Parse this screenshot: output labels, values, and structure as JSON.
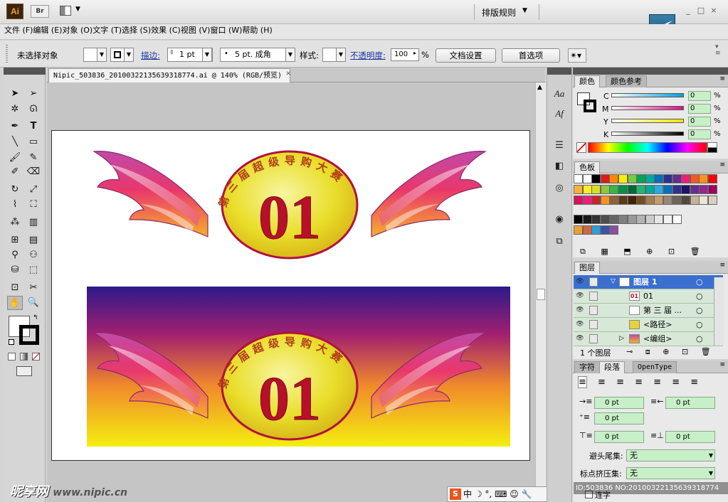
{
  "app": {
    "logo": "Ai",
    "bridge": "Br",
    "workspace": "排版规则",
    "window_controls": [
      "_",
      "□",
      "×"
    ]
  },
  "menu": [
    "文件 (F)",
    "编辑 (E)",
    "对象 (O)",
    "文字 (T)",
    "选择 (S)",
    "效果 (C)",
    "视图 (V)",
    "窗口 (W)",
    "帮助 (H)"
  ],
  "control_bar": {
    "selection_status": "未选择对象",
    "stroke_label": "描边:",
    "stroke_weight": "1 pt",
    "brush": "5 pt. 成角",
    "style_label": "样式:",
    "opacity_label": "不透明度:",
    "opacity_value": "100",
    "opacity_unit": "%",
    "doc_setup_button": "文档设置",
    "preferences_button": "首选项"
  },
  "document": {
    "tab_title": "Nipic_503836_20100322135639318774.ai @ 140% (RGB/预览)",
    "close_glyph": "×"
  },
  "artwork": {
    "badge_top": {
      "number": "01",
      "arc_text": [
        "第",
        "三",
        "届",
        "超",
        "级",
        "导",
        "购",
        "大",
        "赛"
      ]
    },
    "badge_bottom": {
      "number": "01",
      "arc_text": [
        "第",
        "三",
        "届",
        "超",
        "级",
        "导",
        "购",
        "大",
        "赛"
      ]
    }
  },
  "color_panel": {
    "tabs": [
      "颜色",
      "颜色参考"
    ],
    "channels": [
      {
        "label": "C",
        "value": "0",
        "unit": "%"
      },
      {
        "label": "M",
        "value": "0",
        "unit": "%"
      },
      {
        "label": "Y",
        "value": "0",
        "unit": "%"
      },
      {
        "label": "K",
        "value": "0",
        "unit": "%"
      }
    ]
  },
  "swatches_panel": {
    "tab": "色板"
  },
  "layers_panel": {
    "tab": "图层",
    "rows": [
      {
        "name": "图层 1",
        "selected": true
      },
      {
        "name": "01",
        "selected": false
      },
      {
        "name": "第 三 届 ...",
        "selected": false
      },
      {
        "name": "<路径>",
        "selected": false
      },
      {
        "name": "<编组>",
        "selected": false
      }
    ],
    "footer": "1 个图层"
  },
  "paragraph_panel": {
    "tabs": [
      "字符",
      "段落",
      "OpenType"
    ],
    "fields": [
      "0 pt",
      "0 pt",
      "0 pt",
      "0 pt",
      "0 pt"
    ],
    "kinsoku_label": "避头尾集:",
    "kinsoku_value": "无",
    "mojikumi_label": "标点挤压集:",
    "mojikumi_value": "无",
    "hyphen_label": "连字"
  },
  "watermark": {
    "left_brand": "昵享网",
    "left_url": "www.nipic.cn",
    "right_id": "ID:503836 NO:20100322135639318774"
  },
  "ime": {
    "logo": "S",
    "mode": "中"
  },
  "colors": {
    "accent_selected": "#3a6fd0",
    "field_green": "#c8f0c8",
    "badge_red": "#b8102a",
    "badge_gold": "#f3d21c"
  }
}
